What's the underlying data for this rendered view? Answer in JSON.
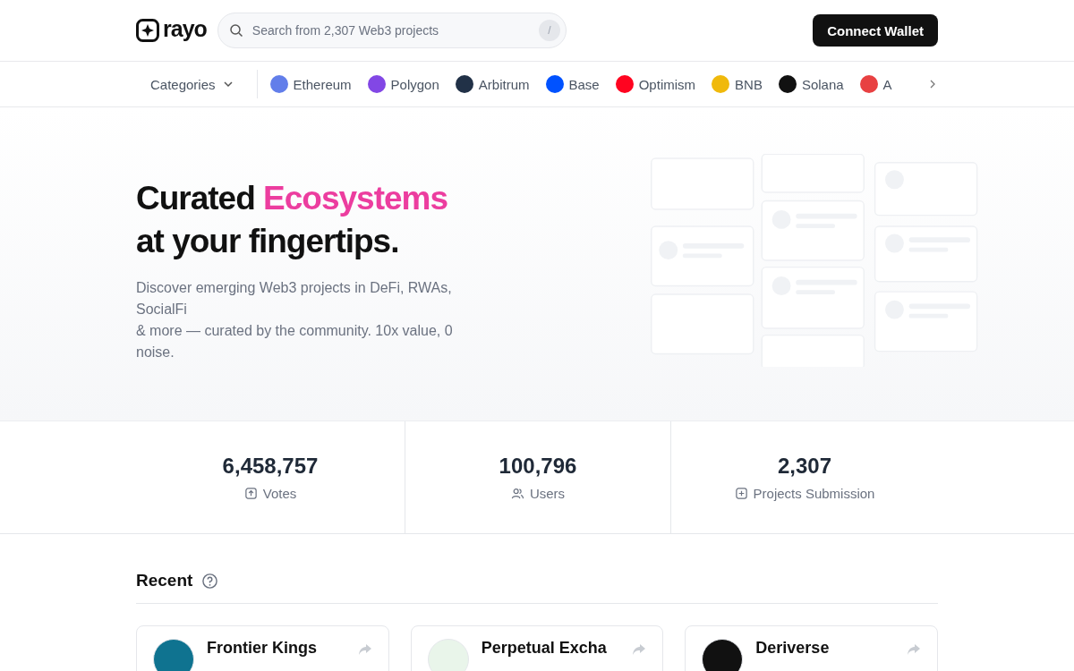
{
  "header": {
    "logo": "rayo",
    "search": {
      "placeholder": "Search from 2,307 Web3 projects",
      "shortcut": "/"
    },
    "connect_button": "Connect Wallet"
  },
  "nav": {
    "categories": "Categories",
    "chains": [
      {
        "name": "Ethereum",
        "color": "#627eea"
      },
      {
        "name": "Polygon",
        "color": "#8247e5"
      },
      {
        "name": "Arbitrum",
        "color": "#213147"
      },
      {
        "name": "Base",
        "color": "#0052ff"
      },
      {
        "name": "Optimism",
        "color": "#ff0420"
      },
      {
        "name": "BNB",
        "color": "#f0b90b"
      },
      {
        "name": "Solana",
        "color": "#111111"
      },
      {
        "name": "A",
        "color": "#e84142"
      }
    ]
  },
  "hero": {
    "title_plain": "Curated",
    "title_accent": "Ecosystems",
    "title_line2": "at your fingertips.",
    "subtitle_lines": [
      "Discover emerging Web3 projects in DeFi, RWAs, SocialFi",
      "& more — curated by the community. 10x value, 0 noise."
    ]
  },
  "stats": [
    {
      "value": "6,458,757",
      "label": "Votes",
      "kind": "votes"
    },
    {
      "value": "100,796",
      "label": "Users",
      "kind": "users"
    },
    {
      "value": "2,307",
      "label": "Projects Submission",
      "kind": "submission"
    }
  ],
  "recent": {
    "title": "Recent",
    "projects": [
      {
        "name": "Frontier Kings",
        "color": "#0f7390"
      },
      {
        "name": "Perpetual Excha",
        "color": "#e9f5ea"
      },
      {
        "name": "Deriverse",
        "color": "#111111"
      }
    ]
  }
}
